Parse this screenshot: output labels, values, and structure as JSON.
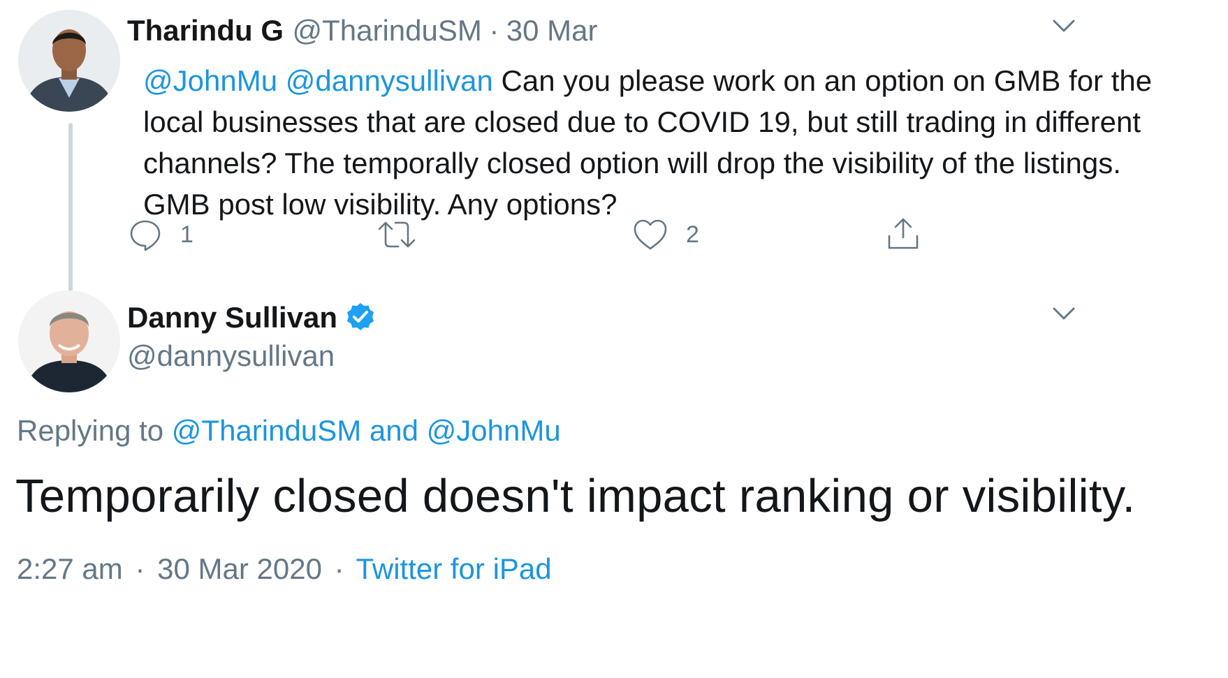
{
  "tweet1": {
    "display_name": "Tharindu G",
    "handle": "@TharinduSM",
    "separator": "·",
    "date": "30 Mar",
    "mentions": [
      "@JohnMu",
      "@dannysullivan"
    ],
    "text": "Can you please work on an option on GMB  for the local businesses that are closed due to COVID 19, but still trading in different channels?  The temporally closed option will drop the visibility of the listings. GMB post low visibility. Any options?",
    "actions": {
      "reply_count": "1",
      "retweet_count": "",
      "like_count": "2"
    },
    "icons": [
      "reply-icon",
      "retweet-icon",
      "like-icon",
      "share-icon",
      "chevron-down-icon"
    ]
  },
  "tweet2": {
    "display_name": "Danny Sullivan",
    "verified": true,
    "handle": "@dannysullivan",
    "replying_to_label": "Replying to",
    "replying_to": [
      "@TharinduSM",
      "@JohnMu"
    ],
    "replying_conjunction": "and",
    "text": "Temporarily closed doesn't impact ranking or visibility.",
    "time": "2:27 am",
    "separator": "·",
    "date": "30 Mar 2020",
    "source": "Twitter for iPad"
  },
  "colors": {
    "link": "#1b95e0",
    "muted": "#657786",
    "text": "#14171a",
    "verified": "#1da1f2",
    "thread_line": "#ccd6dd"
  }
}
